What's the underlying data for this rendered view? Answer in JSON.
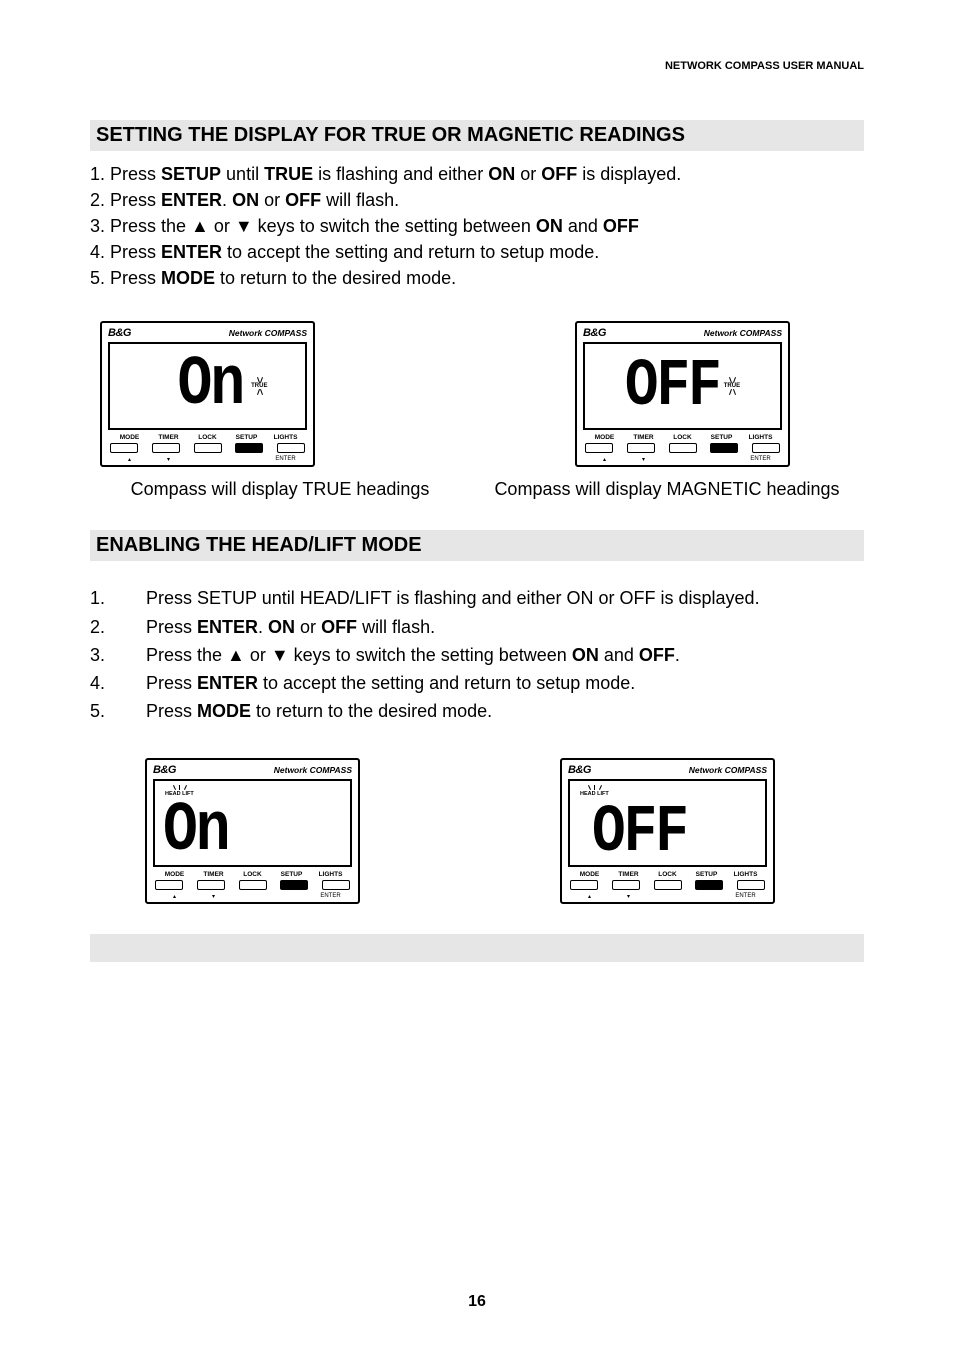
{
  "header": {
    "top_right": "NETWORK COMPASS USER MANUAL"
  },
  "sections": {
    "s1": {
      "heading": "SETTING THE DISPLAY FOR TRUE OR MAGNETIC READINGS",
      "lines": {
        "l1a": "1. Press ",
        "l1b": "SETUP",
        "l1c": " until ",
        "l1d": "TRUE",
        "l1e": " is flashing and either ",
        "l1f": "ON",
        "l1g": " or ",
        "l1h": "OFF",
        "l1i": " is displayed.",
        "l2a": "2. Press ",
        "l2b": "ENTER",
        "l2c": ". ",
        "l2d": "ON",
        "l2e": " or ",
        "l2f": "OFF",
        "l2g": " will flash.",
        "l3a": "3. Press the ▲ or ▼ keys to switch the setting between ",
        "l3b": "ON",
        "l3c": " and ",
        "l3d": "OFF",
        "l4a": "4. Press ",
        "l4b": "ENTER",
        "l4c": " to accept the setting and return to setup mode.",
        "l5a": "5. Press ",
        "l5b": "MODE",
        "l5c": " to return to the desired mode."
      },
      "caption1": "Compass will display TRUE headings",
      "caption2": "Compass will display MAGNETIC headings"
    },
    "s2": {
      "heading": "ENABLING THE HEAD/LIFT MODE",
      "rows": {
        "r1n": "1.",
        "r1t": "Press SETUP until HEAD/LIFT is flashing and either ON or OFF is displayed.",
        "r2n": "2.",
        "r2a": "Press ",
        "r2b": "ENTER",
        "r2c": ". ",
        "r2d": "ON",
        "r2e": " or ",
        "r2f": "OFF",
        "r2g": " will flash.",
        "r3n": "3.",
        "r3a": "Press the ▲ or ▼ keys to switch the setting between ",
        "r3b": "ON",
        "r3c": " and ",
        "r3d": "OFF",
        "r3e": ".",
        "r4n": "4.",
        "r4a": "Press ",
        "r4b": "ENTER",
        "r4c": " to accept the setting and return to setup mode.",
        "r5n": "5.",
        "r5a": "Press ",
        "r5b": "MODE",
        "r5c": " to return to the desired mode."
      }
    }
  },
  "device": {
    "brand": "B&G",
    "model": "Network COMPASS",
    "btn_labels": {
      "b1": "MODE",
      "b2": "TIMER",
      "b3": "LOCK",
      "b4": "SETUP",
      "b5": "LIGHTS"
    },
    "sub_labels": {
      "s1": "▴",
      "s2": "▾",
      "s3": "",
      "s4": "",
      "s5": "ENTER"
    },
    "displays": {
      "on": "On",
      "off": "OFF",
      "true_label": "TRUE",
      "hl_label": "HEAD  LIFT"
    }
  },
  "page_number": "16"
}
